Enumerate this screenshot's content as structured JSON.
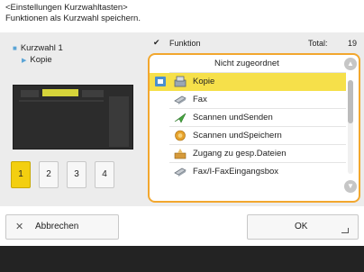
{
  "header": {
    "line1": "<Einstellungen Kurzwahltasten>",
    "line2": "Funktionen als Kurzwahl speichern."
  },
  "left": {
    "title": "Kurzwahl 1",
    "subtitle": "Kopie",
    "pages": [
      "1",
      "2",
      "3",
      "4"
    ],
    "active_page": "1"
  },
  "list": {
    "check_mark": "✔",
    "function_label": "Funktion",
    "total_label": "Total:",
    "total_value": "19",
    "items": [
      {
        "label": "Nicht zugeordnet",
        "icon": "none",
        "selected": false
      },
      {
        "label": "Kopie",
        "icon": "copy-icon",
        "selected": true
      },
      {
        "label": "Fax",
        "icon": "fax-icon",
        "selected": false
      },
      {
        "label": "Scannen undSenden",
        "icon": "scan-send-icon",
        "selected": false
      },
      {
        "label": "Scannen undSpeichern",
        "icon": "scan-store-icon",
        "selected": false
      },
      {
        "label": "Zugang zu gesp.Dateien",
        "icon": "stored-files-icon",
        "selected": false
      },
      {
        "label": "Fax/I-FaxEingangsbox",
        "icon": "fax-inbox-icon",
        "selected": false
      }
    ]
  },
  "buttons": {
    "cancel": "Abbrechen",
    "ok": "OK"
  },
  "colors": {
    "accent": "#f3cf10",
    "list_border": "#f2a72e",
    "selected_row": "#f6e04a",
    "assigned_marker": "#4a8fd0"
  }
}
